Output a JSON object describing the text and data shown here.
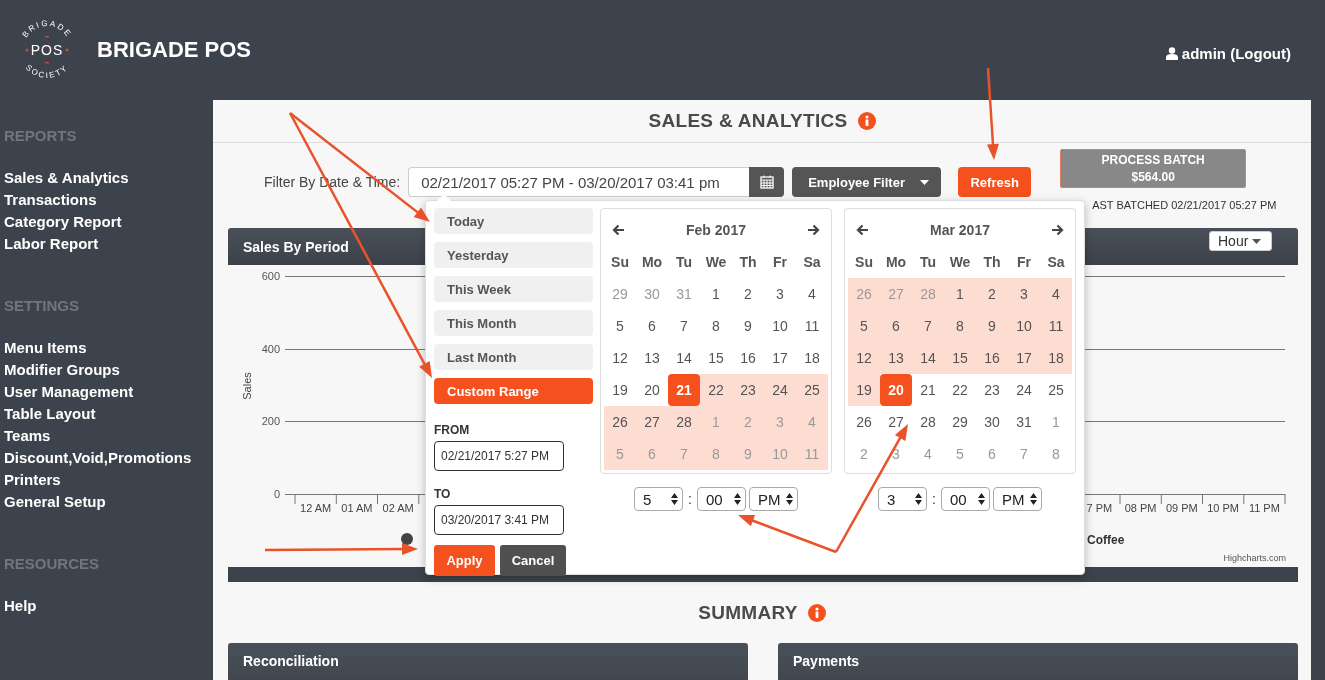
{
  "header": {
    "logo": {
      "ring_top": "BRIGADE",
      "center": "POS",
      "ring_bottom": "SOCIETY"
    },
    "title": "BRIGADE POS",
    "user": "admin (Logout)"
  },
  "sidebar": {
    "sections": [
      {
        "heading": "REPORTS",
        "items": [
          "Sales & Analytics",
          "Transactions",
          "Category Report",
          "Labor Report"
        ]
      },
      {
        "heading": "SETTINGS",
        "items": [
          "Menu Items",
          "Modifier Groups",
          "User Management",
          "Table Layout",
          "Teams",
          "Discount,Void,Promotions",
          "Printers",
          "General Setup"
        ]
      },
      {
        "heading": "RESOURCES",
        "items": [
          "Help"
        ]
      }
    ]
  },
  "page": {
    "title": "SALES & ANALYTICS",
    "filter": {
      "label": "Filter By Date & Time:",
      "value": "02/21/2017 05:27 PM - 03/20/2017 03:41 pm",
      "employee_filter": "Employee Filter",
      "refresh": "Refresh"
    },
    "batch": {
      "label": "PROCESS BATCH",
      "amount": "$564.00",
      "last_batched": "AST BATCHED 02/21/2017 05:27 PM"
    },
    "chart": {
      "title": "Sales By Period",
      "interval": "Hour",
      "ylabel": "Sales",
      "yticks": [
        "600",
        "400",
        "200",
        "0"
      ],
      "xlabels_left": [
        "12 AM",
        "01 AM",
        "02 AM"
      ],
      "xlabels_right": [
        "7 PM",
        "08 PM",
        "09 PM",
        "10 PM",
        "11 PM"
      ],
      "legend": [
        "Coffee"
      ],
      "credit": "Highcharts.com"
    },
    "summary": {
      "title": "SUMMARY",
      "panels": [
        "Reconciliation",
        "Payments"
      ]
    }
  },
  "date_picker": {
    "ranges": [
      {
        "label": "Today",
        "selected": false
      },
      {
        "label": "Yesterday",
        "selected": false
      },
      {
        "label": "This Week",
        "selected": false
      },
      {
        "label": "This Month",
        "selected": false
      },
      {
        "label": "Last Month",
        "selected": false
      },
      {
        "label": "Custom Range",
        "selected": true
      }
    ],
    "from_label": "FROM",
    "from": "02/21/2017 5:27 PM",
    "to_label": "TO",
    "to": "03/20/2017 3:41 PM",
    "apply": "Apply",
    "cancel": "Cancel",
    "calendars": [
      {
        "title": "Feb 2017",
        "weekdays": [
          "Su",
          "Mo",
          "Tu",
          "We",
          "Th",
          "Fr",
          "Sa"
        ],
        "time": {
          "hour": "5",
          "separator": ":",
          "minute": "00",
          "ampm": "PM"
        },
        "weeks": [
          [
            {
              "day": "29",
              "off": true,
              "in_range": false,
              "selected": false
            },
            {
              "day": "30",
              "off": true,
              "in_range": false,
              "selected": false
            },
            {
              "day": "31",
              "off": true,
              "in_range": false,
              "selected": false
            },
            {
              "day": "1",
              "off": false,
              "in_range": false,
              "selected": false
            },
            {
              "day": "2",
              "off": false,
              "in_range": false,
              "selected": false
            },
            {
              "day": "3",
              "off": false,
              "in_range": false,
              "selected": false
            },
            {
              "day": "4",
              "off": false,
              "in_range": false,
              "selected": false
            }
          ],
          [
            {
              "day": "5",
              "off": false,
              "in_range": false,
              "selected": false
            },
            {
              "day": "6",
              "off": false,
              "in_range": false,
              "selected": false
            },
            {
              "day": "7",
              "off": false,
              "in_range": false,
              "selected": false
            },
            {
              "day": "8",
              "off": false,
              "in_range": false,
              "selected": false
            },
            {
              "day": "9",
              "off": false,
              "in_range": false,
              "selected": false
            },
            {
              "day": "10",
              "off": false,
              "in_range": false,
              "selected": false
            },
            {
              "day": "11",
              "off": false,
              "in_range": false,
              "selected": false
            }
          ],
          [
            {
              "day": "12",
              "off": false,
              "in_range": false,
              "selected": false
            },
            {
              "day": "13",
              "off": false,
              "in_range": false,
              "selected": false
            },
            {
              "day": "14",
              "off": false,
              "in_range": false,
              "selected": false
            },
            {
              "day": "15",
              "off": false,
              "in_range": false,
              "selected": false
            },
            {
              "day": "16",
              "off": false,
              "in_range": false,
              "selected": false
            },
            {
              "day": "17",
              "off": false,
              "in_range": false,
              "selected": false
            },
            {
              "day": "18",
              "off": false,
              "in_range": false,
              "selected": false
            }
          ],
          [
            {
              "day": "19",
              "off": false,
              "in_range": false,
              "selected": false
            },
            {
              "day": "20",
              "off": false,
              "in_range": false,
              "selected": false
            },
            {
              "day": "21",
              "off": false,
              "in_range": false,
              "selected": true
            },
            {
              "day": "22",
              "off": false,
              "in_range": true,
              "selected": false
            },
            {
              "day": "23",
              "off": false,
              "in_range": true,
              "selected": false
            },
            {
              "day": "24",
              "off": false,
              "in_range": true,
              "selected": false
            },
            {
              "day": "25",
              "off": false,
              "in_range": true,
              "selected": false
            }
          ],
          [
            {
              "day": "26",
              "off": false,
              "in_range": true,
              "selected": false
            },
            {
              "day": "27",
              "off": false,
              "in_range": true,
              "selected": false
            },
            {
              "day": "28",
              "off": false,
              "in_range": true,
              "selected": false
            },
            {
              "day": "1",
              "off": true,
              "in_range": true,
              "selected": false
            },
            {
              "day": "2",
              "off": true,
              "in_range": true,
              "selected": false
            },
            {
              "day": "3",
              "off": true,
              "in_range": true,
              "selected": false
            },
            {
              "day": "4",
              "off": true,
              "in_range": true,
              "selected": false
            }
          ],
          [
            {
              "day": "5",
              "off": true,
              "in_range": true,
              "selected": false
            },
            {
              "day": "6",
              "off": true,
              "in_range": true,
              "selected": false
            },
            {
              "day": "7",
              "off": true,
              "in_range": true,
              "selected": false
            },
            {
              "day": "8",
              "off": true,
              "in_range": true,
              "selected": false
            },
            {
              "day": "9",
              "off": true,
              "in_range": true,
              "selected": false
            },
            {
              "day": "10",
              "off": true,
              "in_range": true,
              "selected": false
            },
            {
              "day": "11",
              "off": true,
              "in_range": true,
              "selected": false
            }
          ]
        ]
      },
      {
        "title": "Mar 2017",
        "weekdays": [
          "Su",
          "Mo",
          "Tu",
          "We",
          "Th",
          "Fr",
          "Sa"
        ],
        "time": {
          "hour": "3",
          "separator": ":",
          "minute": "00",
          "ampm": "PM"
        },
        "weeks": [
          [
            {
              "day": "26",
              "off": true,
              "in_range": true,
              "selected": false
            },
            {
              "day": "27",
              "off": true,
              "in_range": true,
              "selected": false
            },
            {
              "day": "28",
              "off": true,
              "in_range": true,
              "selected": false
            },
            {
              "day": "1",
              "off": false,
              "in_range": true,
              "selected": false
            },
            {
              "day": "2",
              "off": false,
              "in_range": true,
              "selected": false
            },
            {
              "day": "3",
              "off": false,
              "in_range": true,
              "selected": false
            },
            {
              "day": "4",
              "off": false,
              "in_range": true,
              "selected": false
            }
          ],
          [
            {
              "day": "5",
              "off": false,
              "in_range": true,
              "selected": false
            },
            {
              "day": "6",
              "off": false,
              "in_range": true,
              "selected": false
            },
            {
              "day": "7",
              "off": false,
              "in_range": true,
              "selected": false
            },
            {
              "day": "8",
              "off": false,
              "in_range": true,
              "selected": false
            },
            {
              "day": "9",
              "off": false,
              "in_range": true,
              "selected": false
            },
            {
              "day": "10",
              "off": false,
              "in_range": true,
              "selected": false
            },
            {
              "day": "11",
              "off": false,
              "in_range": true,
              "selected": false
            }
          ],
          [
            {
              "day": "12",
              "off": false,
              "in_range": true,
              "selected": false
            },
            {
              "day": "13",
              "off": false,
              "in_range": true,
              "selected": false
            },
            {
              "day": "14",
              "off": false,
              "in_range": true,
              "selected": false
            },
            {
              "day": "15",
              "off": false,
              "in_range": true,
              "selected": false
            },
            {
              "day": "16",
              "off": false,
              "in_range": true,
              "selected": false
            },
            {
              "day": "17",
              "off": false,
              "in_range": true,
              "selected": false
            },
            {
              "day": "18",
              "off": false,
              "in_range": true,
              "selected": false
            }
          ],
          [
            {
              "day": "19",
              "off": false,
              "in_range": true,
              "selected": false
            },
            {
              "day": "20",
              "off": false,
              "in_range": false,
              "selected": true
            },
            {
              "day": "21",
              "off": false,
              "in_range": false,
              "selected": false
            },
            {
              "day": "22",
              "off": false,
              "in_range": false,
              "selected": false
            },
            {
              "day": "23",
              "off": false,
              "in_range": false,
              "selected": false
            },
            {
              "day": "24",
              "off": false,
              "in_range": false,
              "selected": false
            },
            {
              "day": "25",
              "off": false,
              "in_range": false,
              "selected": false
            }
          ],
          [
            {
              "day": "26",
              "off": false,
              "in_range": false,
              "selected": false
            },
            {
              "day": "27",
              "off": false,
              "in_range": false,
              "selected": false
            },
            {
              "day": "28",
              "off": false,
              "in_range": false,
              "selected": false
            },
            {
              "day": "29",
              "off": false,
              "in_range": false,
              "selected": false
            },
            {
              "day": "30",
              "off": false,
              "in_range": false,
              "selected": false
            },
            {
              "day": "31",
              "off": false,
              "in_range": false,
              "selected": false
            },
            {
              "day": "1",
              "off": true,
              "in_range": false,
              "selected": false
            }
          ],
          [
            {
              "day": "2",
              "off": true,
              "in_range": false,
              "selected": false
            },
            {
              "day": "3",
              "off": true,
              "in_range": false,
              "selected": false
            },
            {
              "day": "4",
              "off": true,
              "in_range": false,
              "selected": false
            },
            {
              "day": "5",
              "off": true,
              "in_range": false,
              "selected": false
            },
            {
              "day": "6",
              "off": true,
              "in_range": false,
              "selected": false
            },
            {
              "day": "7",
              "off": true,
              "in_range": false,
              "selected": false
            },
            {
              "day": "8",
              "off": true,
              "in_range": false,
              "selected": false
            }
          ]
        ]
      }
    ]
  }
}
